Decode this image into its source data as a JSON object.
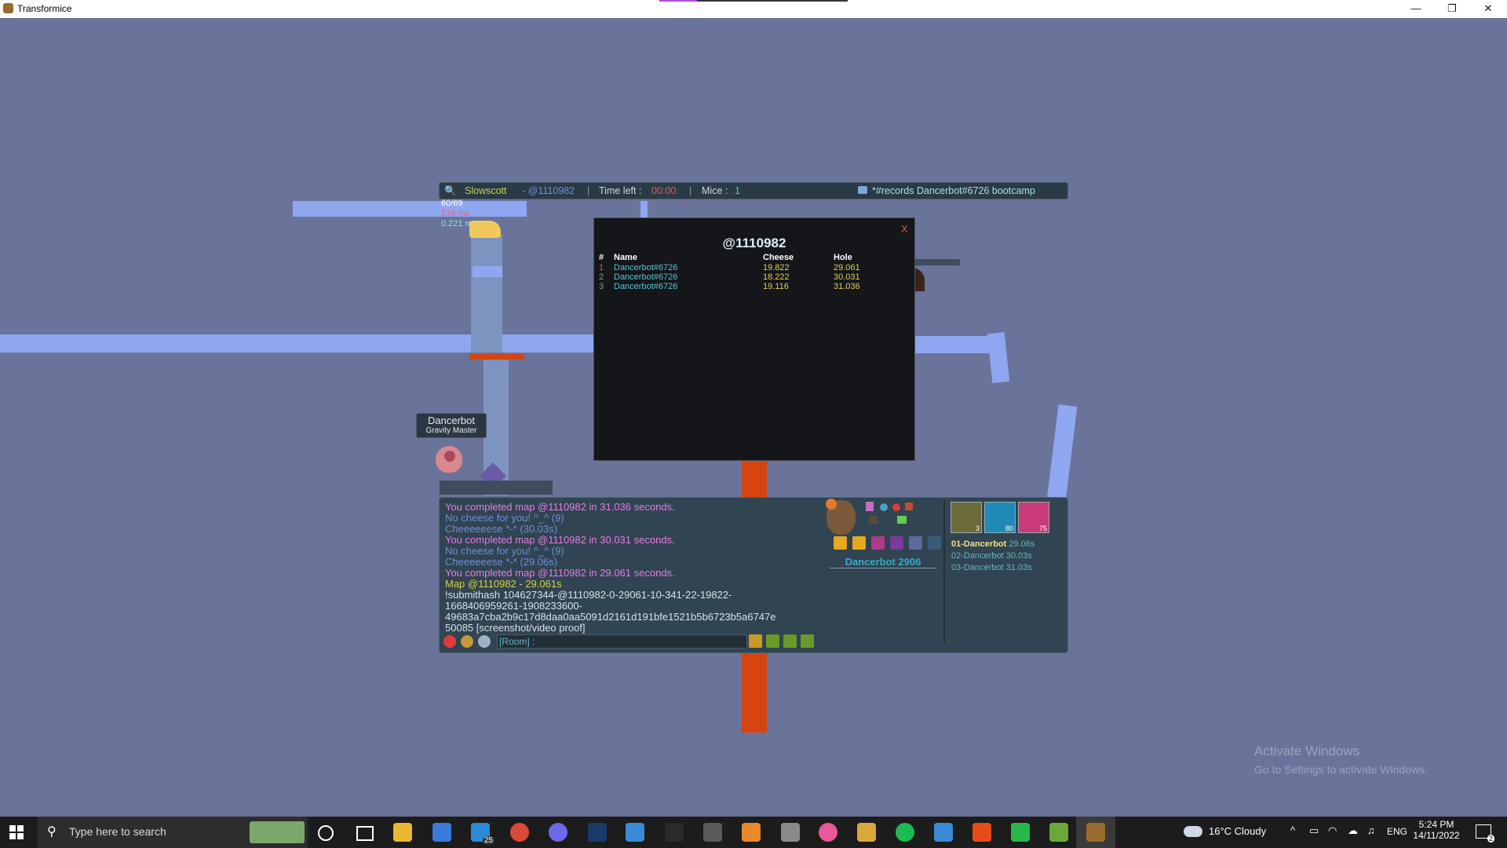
{
  "window": {
    "title": "Transformice",
    "minimize": "—",
    "maximize": "❐",
    "close": "✕"
  },
  "topbar": {
    "author": "Slowscott",
    "map_code": "- @1110982",
    "sep1": "|",
    "time_label": "Time left :",
    "time_value": "00:00",
    "sep2": "|",
    "mice_label": "Mice :",
    "mice_value": "1",
    "sep3": "|",
    "room": "*#records Dancerbot#6726 bootcamp"
  },
  "hud_stats": {
    "line1": "60/69",
    "line2": "210 mo",
    "line3": "0.221 m"
  },
  "player": {
    "name": "Dancerbot",
    "title": "Gravity Master"
  },
  "leaderboard": {
    "title": "@1110982",
    "close": "X",
    "headers": {
      "rank": "#",
      "name": "Name",
      "cheese": "Cheese",
      "hole": "Hole"
    },
    "rows": [
      {
        "rank": "1",
        "name": "Dancerbot#6726",
        "cheese": "19.822",
        "hole": "29.061"
      },
      {
        "rank": "2",
        "name": "Dancerbot#6726",
        "cheese": "18.222",
        "hole": "30.031"
      },
      {
        "rank": "3",
        "name": "Dancerbot#6726",
        "cheese": "19.116",
        "hole": "31.036"
      }
    ]
  },
  "chat": {
    "lines": [
      {
        "text": "You completed map @1110982 in 31.036 seconds.",
        "color": "#e77ae6"
      },
      {
        "text": "No cheese for you! ^_^ (9)",
        "color": "#6c8fd8"
      },
      {
        "text": "Cheeeeeese *-* (30.03s)",
        "color": "#6c8fd8"
      },
      {
        "text": "You completed map @1110982 in 30.031 seconds.",
        "color": "#e77ae6"
      },
      {
        "text": "No cheese for you! ^_^ (9)",
        "color": "#6c8fd8"
      },
      {
        "text": "Cheeeeeese *-* (29.06s)",
        "color": "#6c8fd8"
      },
      {
        "text": "You completed map @1110982 in 29.061 seconds.",
        "color": "#e77ae6"
      },
      {
        "text": "Map @1110982 - 29.061s",
        "color": "#d6d04a"
      },
      {
        "text": "!submithash 104627344-@1110982-0-29061-10-341-22-19822-",
        "color": "#d8e2ea"
      },
      {
        "text": "1668406959261-1908233600-",
        "color": "#d8e2ea"
      },
      {
        "text": "49683a7cba2b9c17d8daa0aa5091d2161d191bfe1521b5b6723b5a6747e",
        "color": "#d8e2ea"
      },
      {
        "text": "50085 [screenshot/video proof]",
        "color": "#d8e2ea"
      }
    ],
    "input_label": "[Room] :",
    "input_value": ""
  },
  "profile": {
    "name": "Dancerbot",
    "level": "2906",
    "badges": [
      "3",
      "80",
      "75"
    ],
    "ranking": [
      {
        "label": "01-Dancerbot",
        "time": "29.06s"
      },
      {
        "label": "02-Dancerbot",
        "time": "30.03s"
      },
      {
        "label": "03-Dancerbot",
        "time": "31.03s"
      }
    ]
  },
  "watermark": {
    "line1": "Activate Windows",
    "line2": "Go to Settings to activate Windows."
  },
  "taskbar": {
    "search_placeholder": "Type here to search",
    "mail_badge": "25",
    "weather": "16°C  Cloudy",
    "lang": "ENG",
    "time": "5:24 PM",
    "date": "14/11/2022",
    "notif_count": "2"
  },
  "colors": {
    "game_bg": "#6a7399",
    "plank": "#8ea7f0",
    "orange": "#d6440f",
    "panel": "#314451"
  }
}
